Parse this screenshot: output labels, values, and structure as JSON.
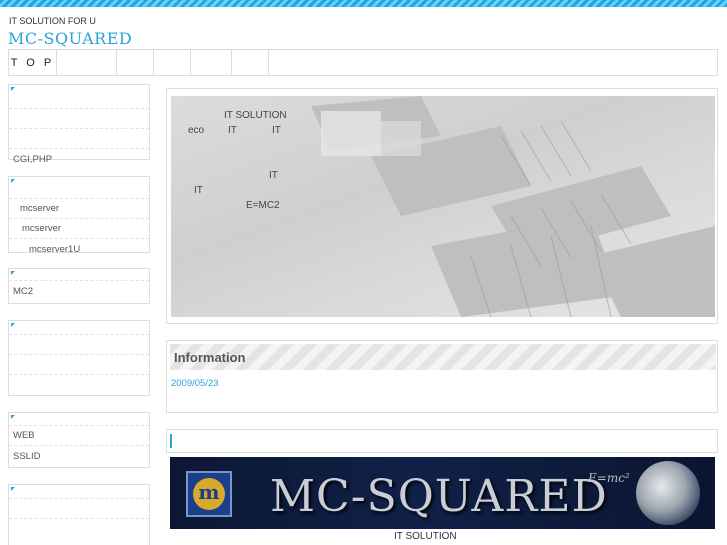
{
  "header": {
    "tagline": "IT SOLUTION FOR U",
    "logo": "MC-SQUARED"
  },
  "nav": {
    "items": [
      "T O P",
      "",
      "",
      "",
      "",
      ""
    ]
  },
  "sidebar": {
    "box1": [
      "",
      "",
      "",
      "CGI,PHP"
    ],
    "box2": [
      "",
      "mcserver",
      "mcserver",
      "mcserver1U"
    ],
    "box3": [
      "",
      "MC2"
    ],
    "box4": [
      "",
      "",
      "",
      "",
      ""
    ],
    "box5": [
      "",
      "WEB",
      "SSLID"
    ],
    "box6": [
      "",
      "",
      "",
      ""
    ]
  },
  "hero": {
    "texts": [
      "IT SOLUTION",
      "eco",
      "IT",
      "IT",
      "IT",
      "IT",
      "E=MC2"
    ]
  },
  "info": {
    "title": "Information",
    "date": "2009/05/23"
  },
  "banner": {
    "title": "MC-SQUARED",
    "formula": "E=mc²",
    "badge": "m"
  },
  "footer": {
    "caption": "IT SOLUTION"
  },
  "colors": {
    "accent": "#2aa3d8",
    "topbar": "#1aa8e6"
  }
}
